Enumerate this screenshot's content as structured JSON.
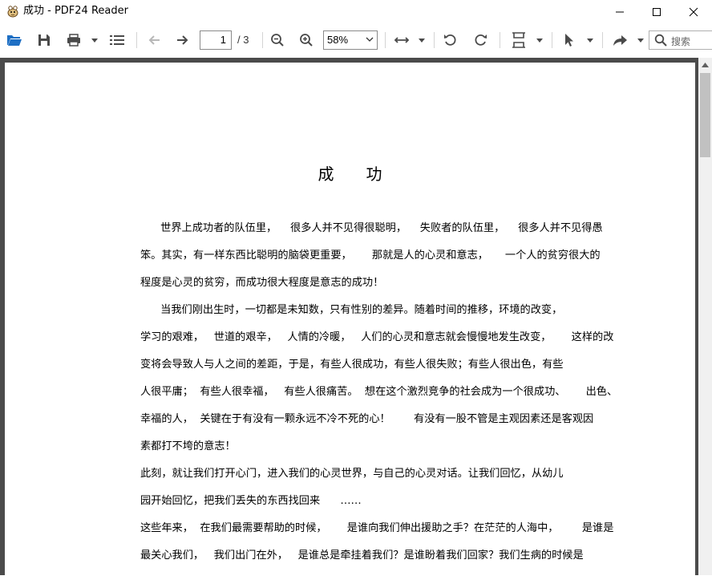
{
  "window": {
    "title": "成功 - PDF24 Reader"
  },
  "toolbar": {
    "page_number": "1",
    "page_total": "/ 3",
    "zoom": "58%",
    "search_placeholder": "搜索",
    "icons": [
      "open-folder-icon",
      "save-icon",
      "print-icon",
      "outline-list-icon",
      "back-arrow-icon",
      "forward-arrow-icon",
      "zoom-out-icon",
      "zoom-in-icon",
      "fit-width-icon",
      "rotate-left-icon",
      "rotate-right-icon",
      "page-layout-icon",
      "pointer-tool-icon",
      "share-icon",
      "search-icon"
    ]
  },
  "document": {
    "title": "成功",
    "lines": [
      "      世界上成功者的队伍里，    很多人并不见得很聪明，    失败者的队伍里，    很多人并不见得愚",
      "笨。其实，有一样东西比聪明的脑袋更重要，      那就是人的心灵和意志，     一个人的贫穷很大的",
      "程度是心灵的贫穷，而成功很大程度是意志的成功！",
      "      当我们刚出生时，一切都是未知数，只有性别的差异。随着时间的推移，环境的改变，",
      "学习的艰难，   世道的艰辛，   人情的冷暖，   人们的心灵和意志就会慢慢地发生改变，      这样的改",
      "变将会导致人与人之间的差距，于是，有些人很成功，有些人很失败；有些人很出色，有些",
      "人很平庸；  有些人很幸福，   有些人很痛苦。  想在这个激烈竞争的社会成为一个很成功、      出色、",
      "幸福的人，  关键在于有没有一颗永远不冷不死的心！       有没有一股不管是主观因素还是客观因",
      "素都打不垮的意志！",
      "此刻，就让我们打开心门，进入我们的心灵世界，与自己的心灵对话。让我们回忆，从幼儿",
      "园开始回忆，把我们丢失的东西找回来      ……",
      "这些年来，  在我们最需要帮助的时候，      是谁向我们伸出援助之手？在茫茫的人海中，       是谁是",
      "最关心我们，   我们出门在外，   是谁总是牵挂着我们？是谁盼着我们回家？我们生病的时候是"
    ]
  },
  "colors": {
    "viewer_bg": "#4b4b4b",
    "accent_blue": "#1e6fc4",
    "icon_gray": "#5a5a5a"
  }
}
